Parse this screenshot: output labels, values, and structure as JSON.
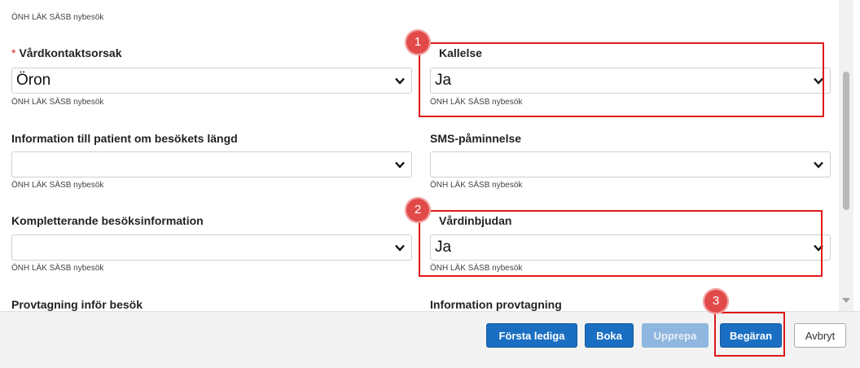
{
  "form": {
    "top_hint": "ÖNH LÄK SÄSB nybesök",
    "fields": [
      {
        "label": "Vårdkontaktsorsak",
        "required": "*",
        "value": "Öron",
        "hint": "ÖNH LÄK SÄSB nybesök"
      },
      {
        "label": "Kallelse",
        "value": "Ja",
        "hint": "ÖNH LÄK SÄSB nybesök"
      },
      {
        "label": "Information till patient om besökets längd",
        "value": "",
        "hint": "ÖNH LÄK SÄSB nybesök"
      },
      {
        "label": "SMS-påminnelse",
        "value": "",
        "hint": "ÖNH LÄK SÄSB nybesök"
      },
      {
        "label": "Kompletterande besöksinformation",
        "value": "",
        "hint": "ÖNH LÄK SÄSB nybesök"
      },
      {
        "label": "Vårdinbjudan",
        "value": "Ja",
        "hint": "ÖNH LÄK SÄSB nybesök"
      },
      {
        "label": "Provtagning inför besök"
      },
      {
        "label": "Information provtagning"
      }
    ]
  },
  "annotations": {
    "badge1": "1",
    "badge2": "2",
    "badge3": "3"
  },
  "footer": {
    "forsta_lediga": "Första lediga",
    "boka": "Boka",
    "upprepa": "Upprepa",
    "begaran": "Begäran",
    "avbryt": "Avbryt"
  },
  "icons": {
    "select_arrow": "chevron-down-icon"
  },
  "colors": {
    "primary": "#1a6fc2",
    "highlight": "#e01919",
    "badge": "#e24a4a",
    "required": "#d9251c"
  }
}
